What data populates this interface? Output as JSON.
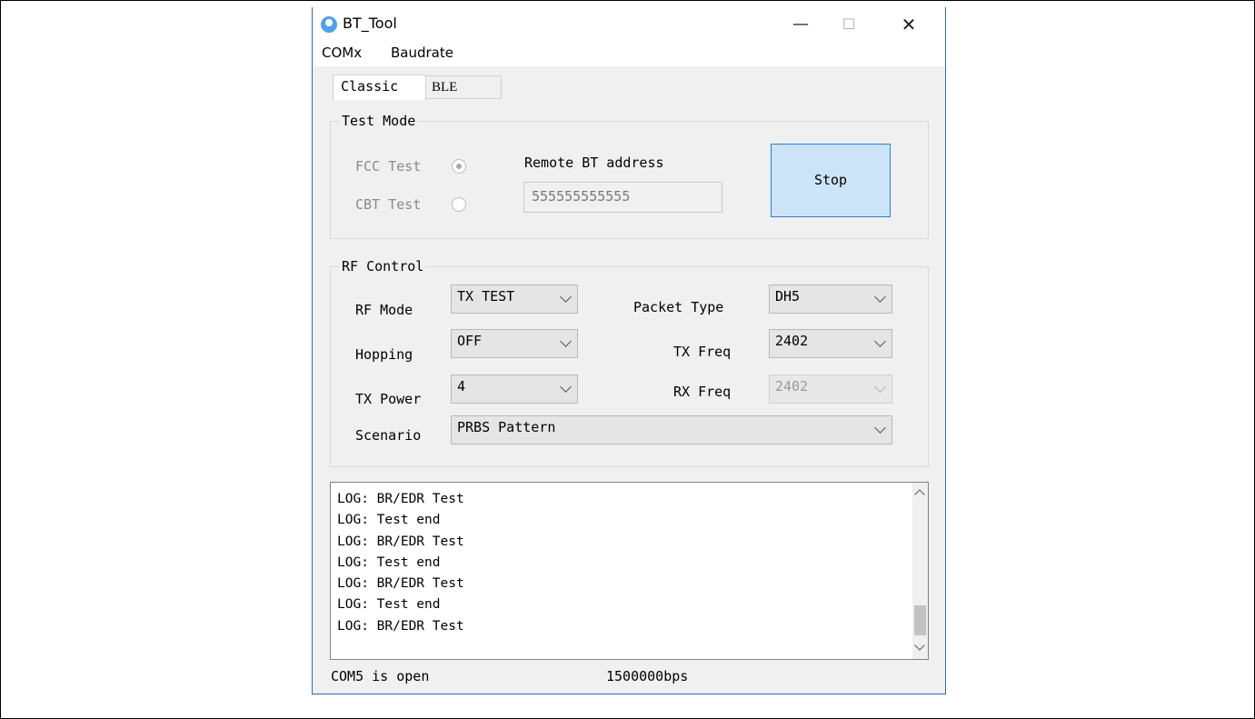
{
  "window": {
    "title": "BT_Tool",
    "min_label": "—",
    "max_label": "☐",
    "close_label": "✕"
  },
  "menu": [
    "COMx",
    "Baudrate"
  ],
  "tabs": [
    "Classic",
    "BLE"
  ],
  "test_mode": {
    "title": "Test Mode",
    "fcc_label": "FCC Test",
    "cbt_label": "CBT Test",
    "fcc_checked": true,
    "remote_label": "Remote BT address",
    "remote_value": "555555555555",
    "stop_label": "Stop"
  },
  "rf_control": {
    "title": "RF Control",
    "rf_mode_label": "RF Mode",
    "rf_mode_value": "TX TEST",
    "packet_type_label": "Packet Type",
    "packet_type_value": "DH5",
    "hopping_label": "Hopping",
    "hopping_value": "OFF",
    "tx_freq_label": "TX Freq",
    "tx_freq_value": "2402",
    "tx_power_label": "TX Power",
    "tx_power_value": "4",
    "rx_freq_label": "RX Freq",
    "rx_freq_value": "2402",
    "scenario_label": "Scenario",
    "scenario_value": "PRBS Pattern"
  },
  "log": [
    "LOG: BR/EDR Test",
    "LOG: Test end",
    "LOG: BR/EDR Test",
    "LOG: Test end",
    "LOG: BR/EDR Test",
    "LOG: Test end",
    "LOG: BR/EDR Test"
  ],
  "status": {
    "port": "COM5 is open",
    "baud": "1500000bps"
  },
  "colors": {
    "accent": "#2d7dd2",
    "button_fill": "#cce4f7"
  }
}
